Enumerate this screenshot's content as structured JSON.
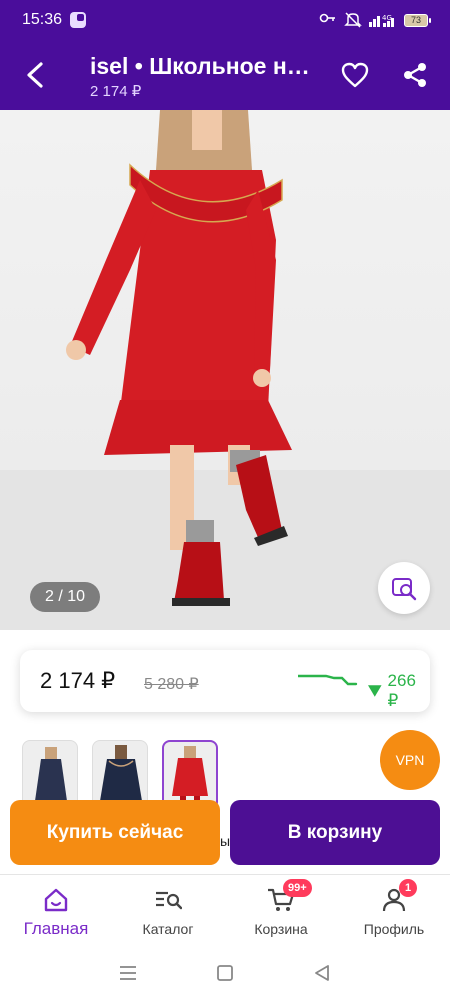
{
  "status_bar": {
    "time": "15:36",
    "battery": "73",
    "vpn": "VPN",
    "network": "4G"
  },
  "header": {
    "title": "isel • Школьное н…",
    "price": "2 174 ₽"
  },
  "gallery": {
    "counter": "2 / 10"
  },
  "price_card": {
    "current": "2 174 ₽",
    "old": "5 280 ₽",
    "drop": "266 ₽",
    "drop_color": "#2bb44a"
  },
  "vpn_button": "VPN",
  "actions": {
    "buy_now": "Купить сейчас",
    "add_to_cart": "В корзину",
    "peek": "ый"
  },
  "bottom_nav": {
    "items": [
      {
        "label": "Главная",
        "icon": "home-icon",
        "active": true
      },
      {
        "label": "Каталог",
        "icon": "catalog-search-icon"
      },
      {
        "label": "Корзина",
        "icon": "cart-icon",
        "badge": "99+"
      },
      {
        "label": "Профиль",
        "icon": "profile-icon",
        "badge": "1"
      }
    ]
  },
  "colors": {
    "brand": "#4a0d9b",
    "accent": "#f58c12",
    "active_nav": "#7a2bc8",
    "badge": "#ff3b5c"
  }
}
